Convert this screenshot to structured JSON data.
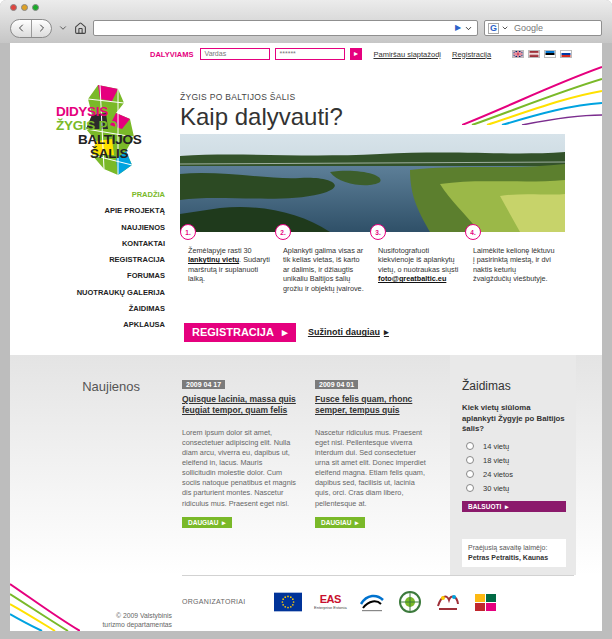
{
  "browser": {
    "go": "▶",
    "search_engine_icon": "G",
    "search_placeholder": "Google"
  },
  "login": {
    "label": "DALYVIAMS",
    "username_placeholder": "Vardas",
    "password_value": "******",
    "submit": "▸",
    "forgot": "Pamiršau slaptažodį",
    "register": "Registracija"
  },
  "logo": {
    "lines": [
      {
        "text": "DIDYSIS",
        "color": "#e5007e"
      },
      {
        "text": "ŽYGIS PO",
        "color": "#7ab929"
      },
      {
        "text": "BALTIJOS",
        "color": "#222222"
      },
      {
        "text": "ŠALIS",
        "color": "#222222"
      }
    ]
  },
  "nav": [
    {
      "label": "PRADŽIA",
      "selected": true
    },
    {
      "label": "APIE PROJEKTĄ",
      "selected": false
    },
    {
      "label": "NAUJIENOS",
      "selected": false
    },
    {
      "label": "KONTAKTAI",
      "selected": false
    },
    {
      "label": "REGISTRACIJA",
      "selected": false
    },
    {
      "label": "FORUMAS",
      "selected": false
    },
    {
      "label": "NUOTRAUKŲ GALERIJA",
      "selected": false
    },
    {
      "label": "ŽAIDIMAS",
      "selected": false
    },
    {
      "label": "APKLAUSA",
      "selected": false
    }
  ],
  "hero": {
    "kicker": "ŽYGIS PO BALTIJOS ŠALIS",
    "title": "Kaip dalyvauti?"
  },
  "steps": [
    {
      "number": "1.",
      "segments": [
        {
          "text": "Žemėlapyje rasti 30 ",
          "bold": false
        },
        {
          "text": "lankytinų vietų",
          "bold": true
        },
        {
          "text": ". Sudaryti maršrutą ir suplanuoti laiką.",
          "bold": false
        }
      ]
    },
    {
      "number": "2.",
      "segments": [
        {
          "text": "Aplankyti galima visas ar tik kelias vietas, iš karto ar dalimis, ir džiaugtis unikaliu Baltijos šalių grožiu ir objektų įvairove.",
          "bold": false
        }
      ]
    },
    {
      "number": "3.",
      "segments": [
        {
          "text": "Nusifotografuoti kiekvienoje iš aplankytų vietų, o nuotraukas siųsti ",
          "bold": false
        },
        {
          "text": "foto@greatbaltic.eu",
          "bold": true
        }
      ]
    },
    {
      "number": "4.",
      "segments": [
        {
          "text": "Laimėkite kelionę lėktuvu į pasirinktą miestą, ir dvi naktis keturių žvaigždučių viešbutyje.",
          "bold": false
        }
      ]
    }
  ],
  "cta": {
    "primary": "REGISTRACIJA",
    "primary_arrow": "▸",
    "secondary": "Sužinoti daugiau",
    "secondary_arrow": "▸"
  },
  "news": {
    "heading": "Naujienos",
    "more": "DAUGIAU",
    "more_arrow": "▸",
    "items": [
      {
        "date": "2009 04 17",
        "title": "Quisque lacinia, massa quis feugiat tempor, quam felis",
        "body": "Lorem ipsum dolor sit amet, consectetuer adipiscing elit. Nulla diam arcu, viverra eu, dapibus ut, eleifend in, lacus. Mauris sollicitudin molestie dolor. Cum sociis natoque penatibus et magnis dis parturient montes. Nascetur ridiculus mus. Praesent eget nisl."
      },
      {
        "date": "2009 04 01",
        "title": "Fusce felis quam, rhonc semper, tempus quis",
        "body": "Nascetur ridiculus mus. Praesent eget nisl. Pellentesque viverra interdum dui. Sed consectetuer urna sit amet elit. Donec imperdiet eleifend magna. Etiam felis quam, dapibus sed, facilisis ut, lacinia quis, orci. Cras diam libero, pellentesque at."
      }
    ]
  },
  "game": {
    "heading": "Žaidimas",
    "question": "Kiek vietų siūloma aplankyti Žygyje po Baltijos šalis?",
    "options": [
      {
        "label": "14 vietų",
        "selected": false
      },
      {
        "label": "18 vietų",
        "selected": false
      },
      {
        "label": "24 vietos",
        "selected": false
      },
      {
        "label": "30 vietų",
        "selected": false
      }
    ],
    "vote": "BALSUOTI",
    "vote_arrow": "▸",
    "winner_label": "Praėjusią savaitę laimėjo:",
    "winner": "Petras Petraitis, Kaunas"
  },
  "footer": {
    "copyright_lines": [
      "© 2009 Valstybinis",
      "turizmo departamentas"
    ],
    "organizers_label": "ORGANIZATORIAI",
    "eas": "EAS",
    "eas_sub": "Enterprise Estonia"
  }
}
